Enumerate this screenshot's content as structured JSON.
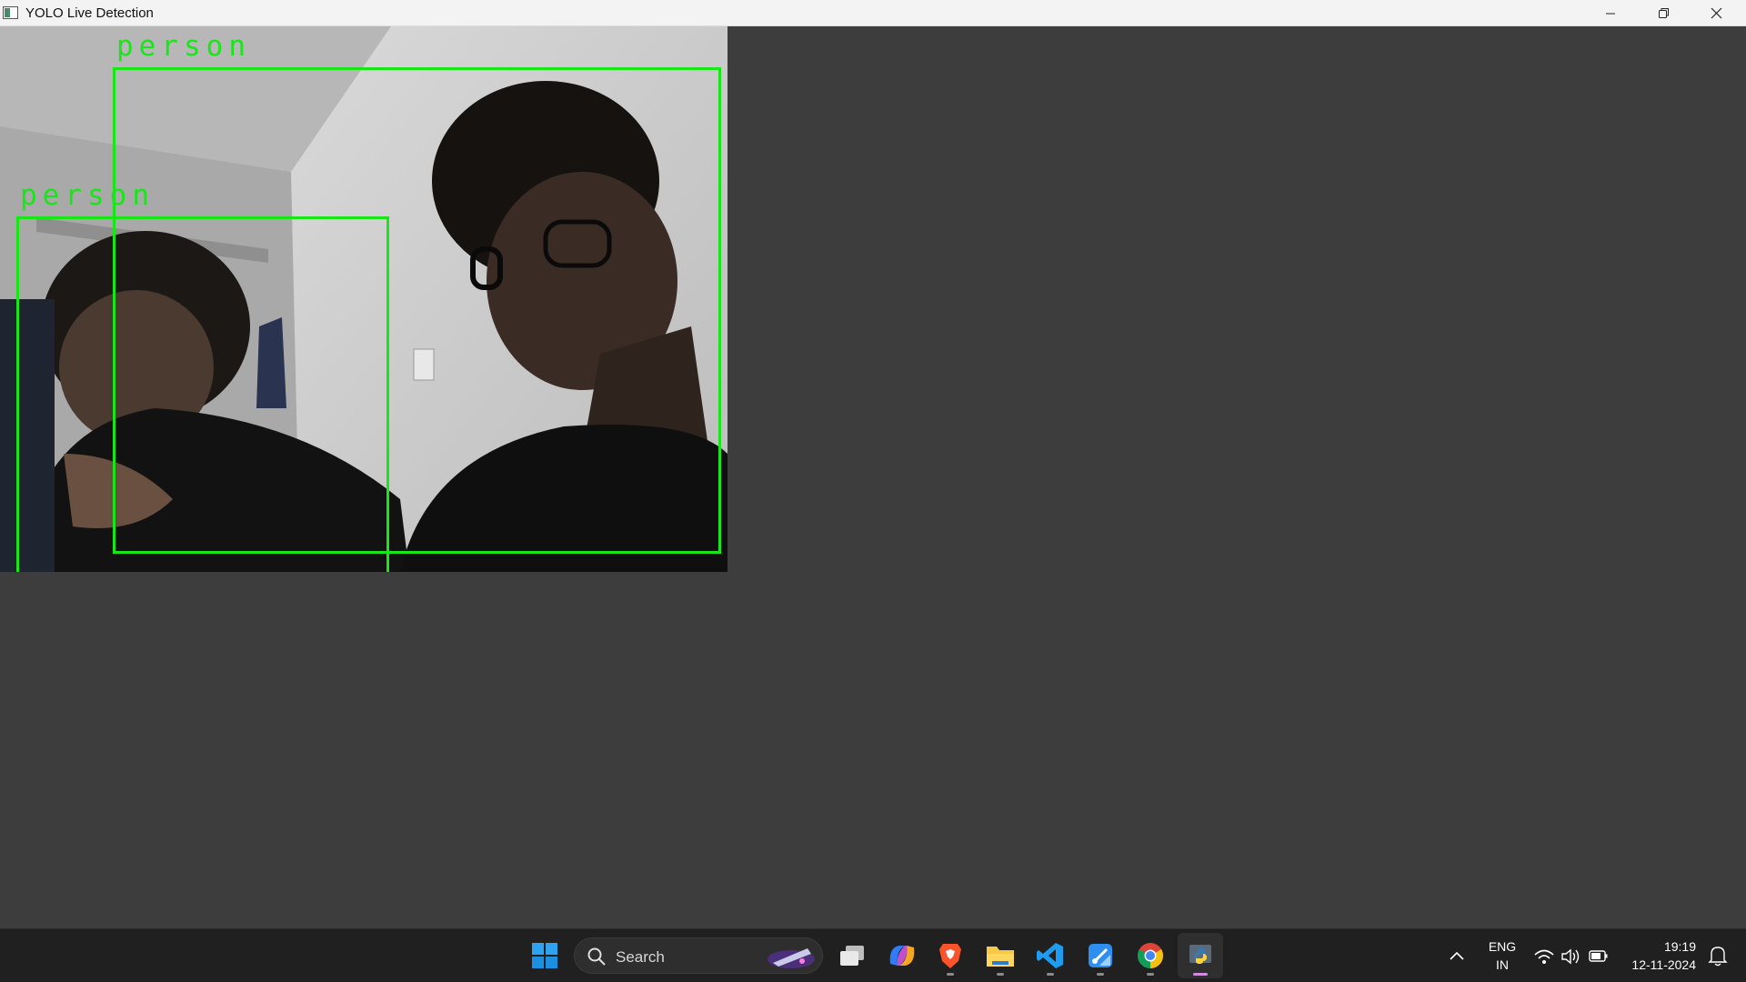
{
  "window": {
    "title": "YOLO Live Detection",
    "controls": [
      "minimize",
      "restore",
      "close"
    ]
  },
  "detections": [
    {
      "label": "person"
    },
    {
      "label": "person"
    }
  ],
  "colors": {
    "bbox": "#19e619",
    "workspace": "#3d3d3d",
    "titlebar": "#f3f3f3",
    "taskbar": "#202020"
  },
  "taskbar": {
    "search_placeholder": "Search",
    "apps": [
      {
        "name": "start",
        "icon": "windows-logo-icon"
      },
      {
        "name": "task-view",
        "icon": "task-view-icon"
      },
      {
        "name": "copilot",
        "icon": "copilot-icon"
      },
      {
        "name": "brave",
        "icon": "brave-browser-icon",
        "running": true
      },
      {
        "name": "file-explorer",
        "icon": "folder-icon",
        "running": true
      },
      {
        "name": "vscode",
        "icon": "vscode-icon",
        "running": true
      },
      {
        "name": "snipping",
        "icon": "snipping-tool-icon",
        "running": true
      },
      {
        "name": "chrome",
        "icon": "chrome-icon",
        "running": true
      },
      {
        "name": "python",
        "icon": "python-icon",
        "running": true,
        "active": true
      }
    ],
    "tray": {
      "language_line1": "ENG",
      "language_line2": "IN",
      "time": "19:19",
      "date": "12-11-2024"
    }
  }
}
